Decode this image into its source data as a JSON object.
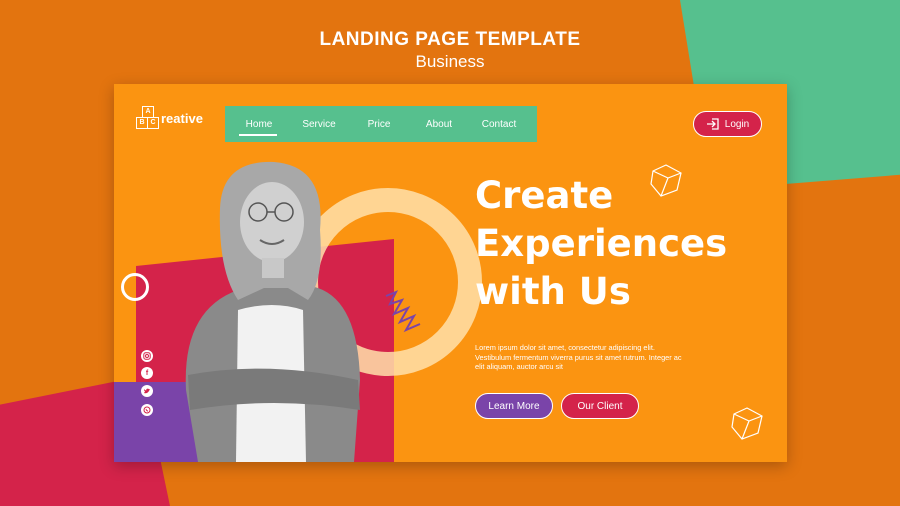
{
  "header": {
    "title": "LANDING PAGE TEMPLATE",
    "subtitle": "Business"
  },
  "logo": {
    "blocks": [
      "A",
      "B",
      "C"
    ],
    "text": "reative"
  },
  "nav": {
    "items": [
      "Home",
      "Service",
      "Price",
      "About",
      "Contact"
    ],
    "active": "Home"
  },
  "login": {
    "label": "Login",
    "icon": "login-icon"
  },
  "hero": {
    "headline": [
      "Create",
      "Experiences",
      "with Us"
    ],
    "body": "Lorem ipsum dolor sit amet, consectetur adipiscing elit. Vestibulum fermentum viverra purus sit amet rutrum. Integer ac elit aliquam, auctor arcu sit",
    "buttons": {
      "learn_more": "Learn More",
      "our_client": "Our Client"
    }
  },
  "social": [
    "instagram-icon",
    "facebook-icon",
    "twitter-icon",
    "whatsapp-icon"
  ],
  "colors": {
    "background": "#e3740f",
    "card": "#fb9411",
    "green": "#56c08e",
    "red": "#d4234a",
    "purple": "#7a44a9"
  }
}
